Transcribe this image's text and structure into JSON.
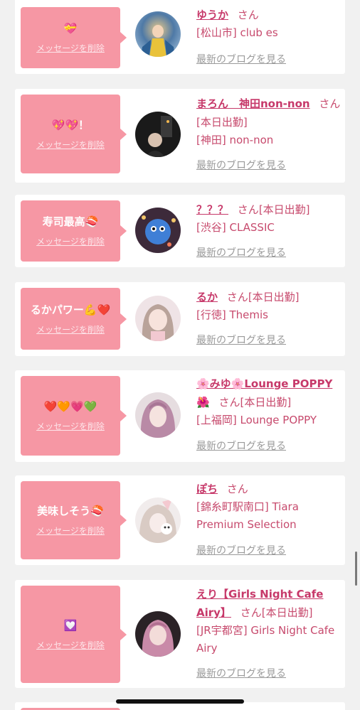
{
  "common": {
    "delete_label": "メッセージを削除",
    "blog_label": "最新のブログを見る",
    "san": "さん"
  },
  "entries": [
    {
      "message": "💝",
      "name": "ゆうか",
      "status": "",
      "shop": "[松山市] club es"
    },
    {
      "message": "💖💖！",
      "name": "まろん　神田non-non",
      "status": "[本日出勤]",
      "shop": "[神田] non-non"
    },
    {
      "message": "寿司最高🍣",
      "name": "？？？",
      "status": "[本日出勤]",
      "shop": "[渋谷] CLASSIC"
    },
    {
      "message": "るかパワー💪❤️",
      "name": "るか",
      "status": "[本日出勤]",
      "shop": "[行徳] Themis"
    },
    {
      "message": "❤️🧡💗💚",
      "name": "🌸みゆ🌸Lounge POPPY",
      "name_suffix": "🌺",
      "status": "[本日出勤]",
      "shop": "[上福岡] Lounge POPPY"
    },
    {
      "message": "美味しそう🍣",
      "name": "ぽち",
      "status": "",
      "shop": "[錦糸町駅南口] Tiara Premium Selection"
    },
    {
      "message": "💟",
      "name": "えり【Girls Night Cafe Airy】",
      "status": "[本日出勤]",
      "shop": "[JR宇都宮] Girls Night Cafe Airy"
    }
  ],
  "colors": {
    "background": "#f1f1f1",
    "bubble": "#f697a4",
    "name": "#c7396a",
    "shop_text": "#c74a6d",
    "blog_link": "#9a9a9a"
  }
}
